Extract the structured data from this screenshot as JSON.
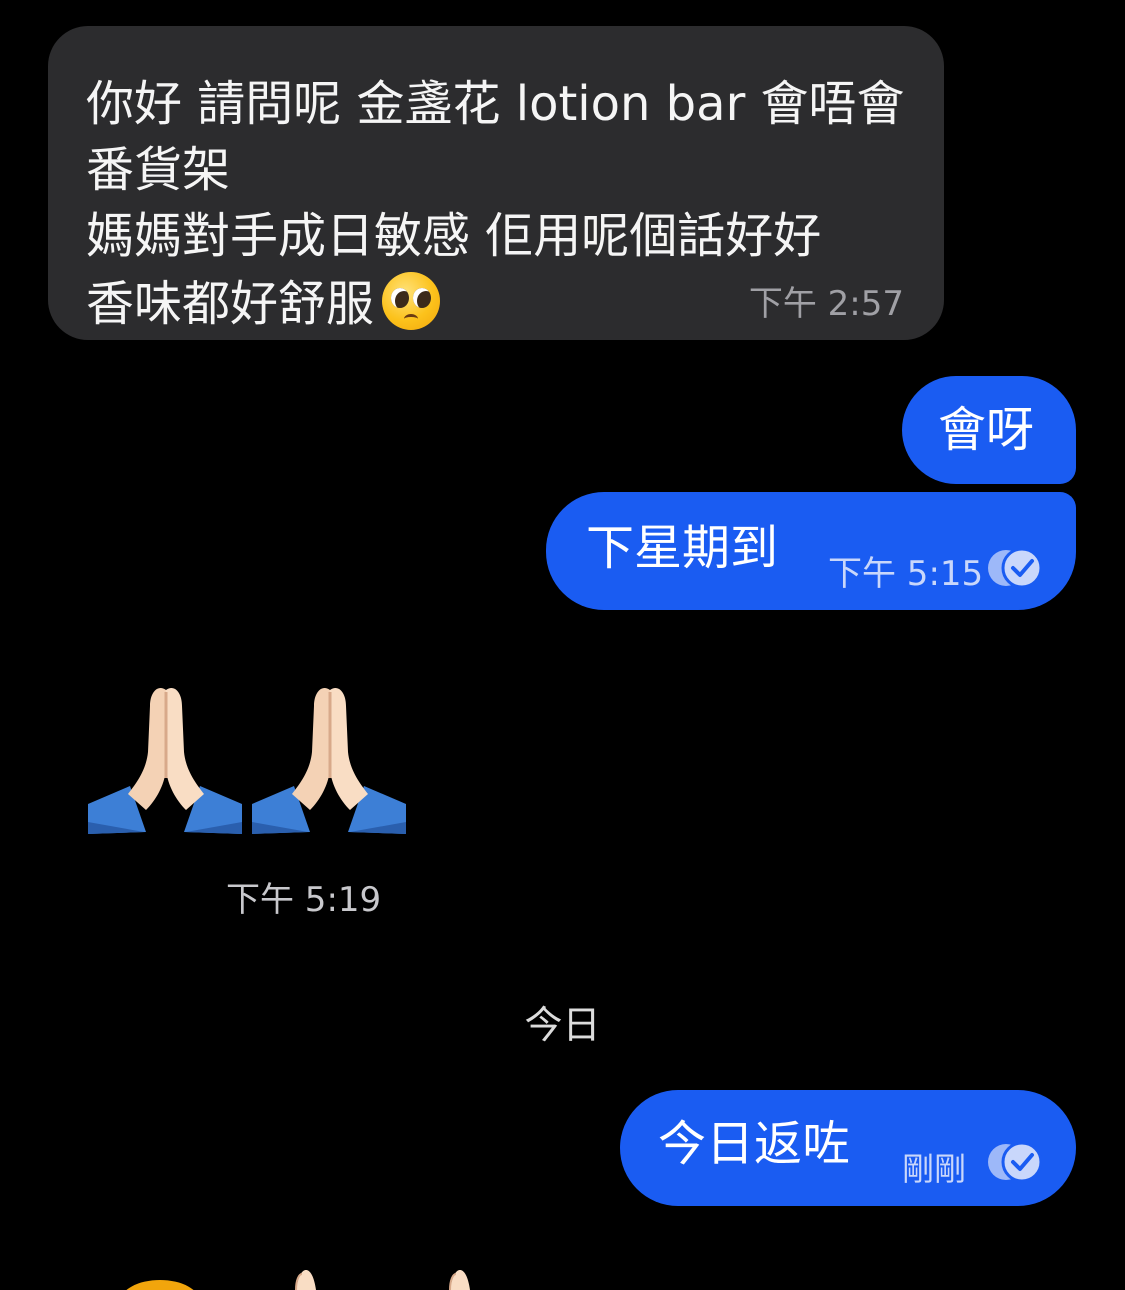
{
  "colors": {
    "background": "#000000",
    "incoming_bubble": "#2c2c2e",
    "outgoing_bubble": "#1a5cf2"
  },
  "messages": {
    "incoming_1": {
      "lines": [
        "你好 請問呢 金盞花 lotion bar 會唔會",
        "番貨架",
        "媽媽對手成日敏感 佢用呢個話好好",
        "香味都好舒服"
      ],
      "emoji": "pleading-face-icon",
      "time": "下午 2:57"
    },
    "outgoing_1": {
      "text": "會呀"
    },
    "outgoing_2": {
      "text": "下星期到",
      "time": "下午 5:15",
      "status_icon": "read-check-icon"
    },
    "incoming_emoji": {
      "emoji": "folded-hands-icon",
      "count": 2,
      "time": "下午 5:19"
    },
    "day_separator": "今日",
    "outgoing_3": {
      "text": "今日返咗",
      "time": "剛剛",
      "status_icon": "read-check-icon"
    }
  }
}
